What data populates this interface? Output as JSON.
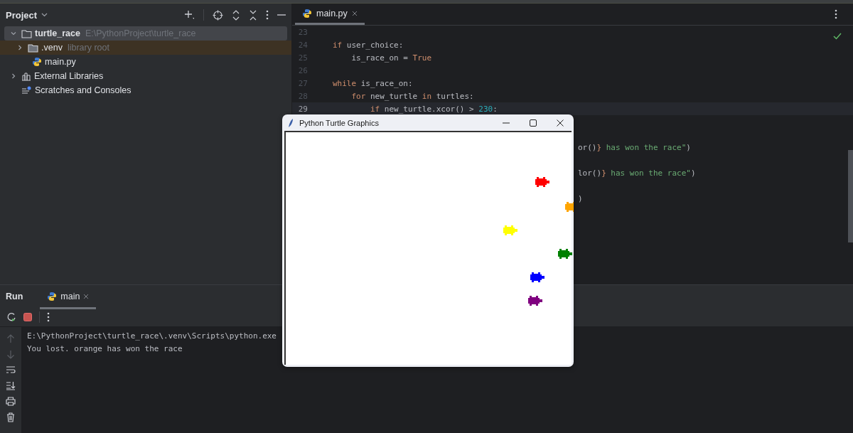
{
  "project_panel": {
    "title": "Project",
    "tree": [
      {
        "label": "turtle_race",
        "hint": "E:\\PythonProject\\turtle_race",
        "kind": "folder",
        "expanded": true,
        "selected": true,
        "children": [
          {
            "label": ".venv",
            "hint": "library root",
            "kind": "folder",
            "expanded": false,
            "selected": false,
            "highlighted": true
          },
          {
            "label": "main.py",
            "kind": "python",
            "selected": false,
            "highlighted": false
          }
        ]
      },
      {
        "label": "External Libraries",
        "kind": "library",
        "expanded": false,
        "selected": false
      },
      {
        "label": "Scratches and Consoles",
        "kind": "scratch",
        "selected": false
      }
    ]
  },
  "editor": {
    "tabs": [
      {
        "label": "main.py",
        "selected": true
      }
    ],
    "lines": [
      {
        "number": "23",
        "current": false
      },
      {
        "number": "24",
        "current": false,
        "tokens": [
          {
            "text": "if",
            "kind": "kw"
          },
          {
            "text": " user_choice:",
            "kind": "plain"
          }
        ]
      },
      {
        "number": "25",
        "current": false,
        "tokens": [
          {
            "text": "    is_race_on = ",
            "kind": "plain"
          },
          {
            "text": "True",
            "kind": "kw"
          }
        ]
      },
      {
        "number": "26",
        "current": false
      },
      {
        "number": "27",
        "current": false,
        "tokens": [
          {
            "text": "while",
            "kind": "kw"
          },
          {
            "text": " is_race_on:",
            "kind": "plain"
          }
        ]
      },
      {
        "number": "28",
        "current": false,
        "tokens": [
          {
            "text": "    for",
            "kind": "kw"
          },
          {
            "text": " new_turtle ",
            "kind": "plain"
          },
          {
            "text": "in",
            "kind": "kw"
          },
          {
            "text": " turtles:",
            "kind": "plain"
          }
        ]
      },
      {
        "number": "29",
        "current": true,
        "tokens": [
          {
            "text": "        if",
            "kind": "kw"
          },
          {
            "text": " new_turtle.xcor() > ",
            "kind": "plain"
          },
          {
            "text": "230",
            "kind": "num"
          },
          {
            "text": ":",
            "kind": "plain"
          }
        ]
      }
    ],
    "line_tails": [
      {
        "tokens": [
          {
            "text": "or()",
            "kind": "plain"
          },
          {
            "text": "}",
            "kind": "kw"
          },
          {
            "text": " has won the race\"",
            "kind": "str"
          },
          {
            "text": ")",
            "kind": "plain"
          }
        ]
      },
      {
        "tokens": [
          {
            "text": "lor()",
            "kind": "plain"
          },
          {
            "text": "}",
            "kind": "kw"
          },
          {
            "text": " has won the race\"",
            "kind": "str"
          },
          {
            "text": ")",
            "kind": "plain"
          }
        ]
      },
      {
        "tokens": [
          {
            "text": ")",
            "kind": "plain"
          }
        ]
      }
    ]
  },
  "run_panel": {
    "title": "Run",
    "tabs": [
      {
        "label": "main",
        "selected": true
      }
    ],
    "output": [
      "E:\\PythonProject\\turtle_race\\.venv\\Scripts\\python.exe",
      "You lost. orange has won the race"
    ]
  },
  "turtle_window": {
    "title": "Python Turtle Graphics",
    "turtles": [
      {
        "color": "#ff0000"
      },
      {
        "color": "#ffa500"
      },
      {
        "color": "#ffff00"
      },
      {
        "color": "#008000"
      },
      {
        "color": "#0000ff"
      },
      {
        "color": "#800080"
      }
    ]
  }
}
